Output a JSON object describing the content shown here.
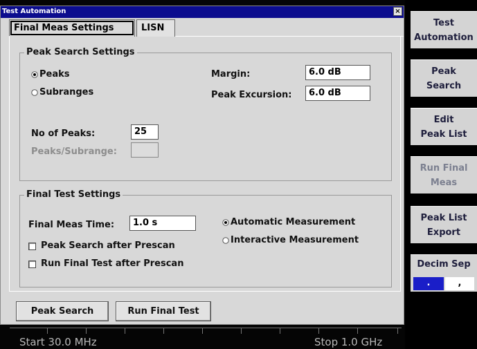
{
  "window": {
    "title": "Test Automation",
    "close_glyph": "×"
  },
  "tabs": [
    {
      "label": "Final Meas Settings",
      "active": true
    },
    {
      "label": "LISN",
      "active": false
    }
  ],
  "peak_search_settings": {
    "title": "Peak Search Settings",
    "radio_peaks": "Peaks",
    "radio_subranges": "Subranges",
    "selected": "Peaks",
    "margin_label": "Margin:",
    "margin_value": "6.0 dB",
    "excursion_label": "Peak Excursion:",
    "excursion_value": "6.0 dB",
    "no_of_peaks_label": "No of Peaks:",
    "no_of_peaks_value": "25",
    "peaks_per_subrange_label": "Peaks/Subrange:",
    "peaks_per_subrange_value": ""
  },
  "final_test_settings": {
    "title": "Final Test Settings",
    "meas_time_label": "Final Meas Time:",
    "meas_time_value": "1.0 s",
    "check_peak_search": "Peak Search after Prescan",
    "check_run_final": "Run Final Test after Prescan",
    "check_peak_search_checked": false,
    "check_run_final_checked": false,
    "radio_automatic": "Automatic Measurement",
    "radio_interactive": "Interactive Measurement",
    "selected": "Automatic Measurement"
  },
  "buttons": {
    "peak_search": "Peak Search",
    "run_final_test": "Run Final Test"
  },
  "softkeys": [
    {
      "line1": "Test",
      "line2": "Automation",
      "enabled": true
    },
    {
      "line1": "Peak",
      "line2": "Search",
      "enabled": true
    },
    {
      "line1": "Edit",
      "line2": "Peak List",
      "enabled": true
    },
    {
      "line1": "Run Final",
      "line2": "Meas",
      "enabled": false
    },
    {
      "line1": "Peak List",
      "line2": "Export",
      "enabled": true
    }
  ],
  "decim_sep": {
    "label": "Decim Sep",
    "option1": ".",
    "option2": ",",
    "selected": "."
  },
  "frequency": {
    "start": "Start 30.0 MHz",
    "stop": "Stop 1.0 GHz"
  },
  "colors": {
    "titlebar": "#0b0c8e",
    "dialog_bg": "#d8d8d8",
    "softkey_bg": "#d4d4d4",
    "accent_blue": "#1a1ec8"
  },
  "icons": {
    "radio_selected": "radio-selected-icon",
    "radio_unselected": "radio-unselected-icon",
    "checkbox": "checkbox-icon",
    "close": "close-icon"
  }
}
